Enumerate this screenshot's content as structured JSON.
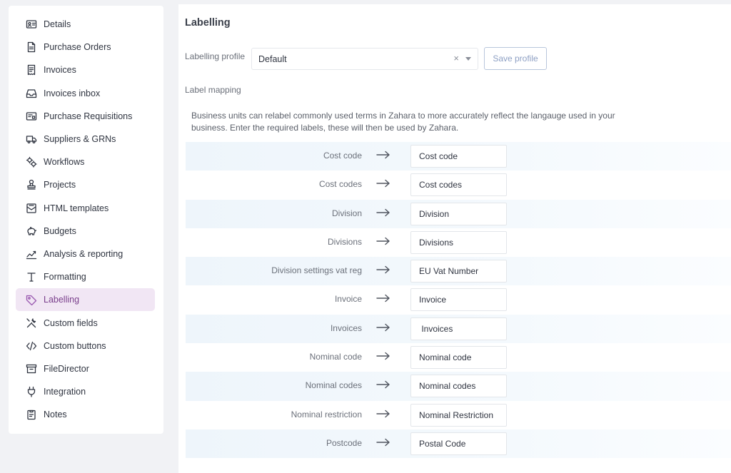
{
  "sidebar": {
    "items": [
      {
        "label": "Details",
        "icon": "id-card-icon",
        "active": false
      },
      {
        "label": "Purchase Orders",
        "icon": "document-icon",
        "active": false
      },
      {
        "label": "Invoices",
        "icon": "receipt-icon",
        "active": false
      },
      {
        "label": "Invoices inbox",
        "icon": "inbox-icon",
        "active": false
      },
      {
        "label": "Purchase Requisitions",
        "icon": "requisition-icon",
        "active": false
      },
      {
        "label": "Suppliers & GRNs",
        "icon": "truck-icon",
        "active": false
      },
      {
        "label": "Workflows",
        "icon": "gears-icon",
        "active": false
      },
      {
        "label": "Projects",
        "icon": "stamp-icon",
        "active": false
      },
      {
        "label": "HTML templates",
        "icon": "mail-template-icon",
        "active": false
      },
      {
        "label": "Budgets",
        "icon": "piggy-bank-icon",
        "active": false
      },
      {
        "label": "Analysis & reporting",
        "icon": "chart-icon",
        "active": false
      },
      {
        "label": "Formatting",
        "icon": "text-format-icon",
        "active": false
      },
      {
        "label": "Labelling",
        "icon": "tag-icon",
        "active": true
      },
      {
        "label": "Custom fields",
        "icon": "tools-icon",
        "active": false
      },
      {
        "label": "Custom buttons",
        "icon": "code-icon",
        "active": false
      },
      {
        "label": "FileDirector",
        "icon": "archive-icon",
        "active": false
      },
      {
        "label": "Integration",
        "icon": "plug-icon",
        "active": false
      },
      {
        "label": "Notes",
        "icon": "clipboard-icon",
        "active": false
      }
    ]
  },
  "main": {
    "title": "Labelling",
    "profile_label": "Labelling profile",
    "profile_value": "Default",
    "clear_glyph": "×",
    "save_button": "Save profile",
    "mapping_label": "Label mapping",
    "description": "Business units can relabel commonly used terms in Zahara to more accurately reflect the langauge used in your business. Enter the required labels, these will then be used by Zahara.",
    "mappings": [
      {
        "source": "Cost code",
        "target": "Cost code"
      },
      {
        "source": "Cost codes",
        "target": "Cost codes"
      },
      {
        "source": "Division",
        "target": "Division"
      },
      {
        "source": "Divisions",
        "target": "Divisions"
      },
      {
        "source": "Division settings vat reg",
        "target": "EU Vat Number"
      },
      {
        "source": "Invoice",
        "target": "Invoice"
      },
      {
        "source": "Invoices",
        "target": " Invoices"
      },
      {
        "source": "Nominal code",
        "target": "Nominal code"
      },
      {
        "source": "Nominal codes",
        "target": "Nominal codes"
      },
      {
        "source": "Nominal restriction",
        "target": "Nominal Restriction"
      },
      {
        "source": "Postcode",
        "target": "Postal Code"
      }
    ]
  },
  "colors": {
    "active_bg": "#f1e6f4",
    "active_text": "#7a3f8c",
    "row_shade": "#eef5fb",
    "save_border": "#b9c6dc"
  }
}
